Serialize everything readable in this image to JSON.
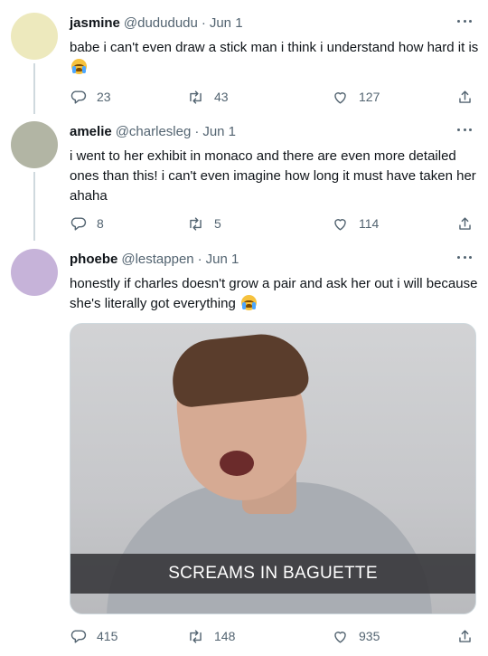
{
  "tweets": [
    {
      "name": "jasmine",
      "handle": "@dudududu",
      "separator": "·",
      "date": "Jun 1",
      "text": "babe i can't even draw a stick man i think i understand how hard it is",
      "emoji": "loudly-crying-face",
      "avatar_color": "#ede9bd",
      "replies": "23",
      "retweets": "43",
      "likes": "127"
    },
    {
      "name": "amelie",
      "handle": "@charlesleg",
      "separator": "·",
      "date": "Jun 1",
      "text": "i went to her exhibit in monaco and there are even more detailed ones than this! i can't even imagine how long it must have taken her ahaha",
      "avatar_color": "#b2b5a4",
      "replies": "8",
      "retweets": "5",
      "likes": "114"
    },
    {
      "name": "phoebe",
      "handle": "@lestappen",
      "separator": "·",
      "date": "Jun 1",
      "text": "honestly if charles doesn't grow a pair and ask her out i will because she's literally got everything",
      "emoji": "loudly-crying-face",
      "avatar_color": "#c6b3d9",
      "media_caption": "SCREAMS IN BAGUETTE",
      "replies": "415",
      "retweets": "148",
      "likes": "935"
    }
  ],
  "colors": {
    "text": "#0f1419",
    "secondary": "#536471",
    "thread_line": "#cfd9de"
  },
  "icons": [
    "reply-icon",
    "retweet-icon",
    "like-icon",
    "share-icon",
    "more-icon"
  ]
}
